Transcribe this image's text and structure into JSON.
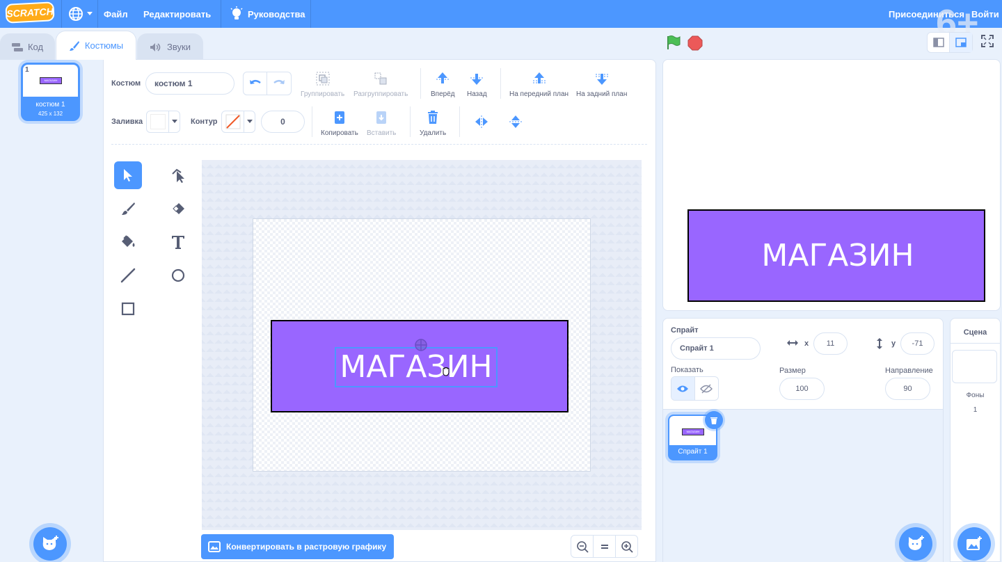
{
  "menu": {
    "logo": "SCRATCH",
    "file": "Файл",
    "edit": "Редактировать",
    "tutorials": "Руководства",
    "join": "Присоединиться",
    "signin": "Войти",
    "age_badge": "6+"
  },
  "tabs": {
    "code": "Код",
    "costumes": "Костюмы",
    "sounds": "Звуки"
  },
  "costume_list": {
    "items": [
      {
        "index": "1",
        "name": "костюм 1",
        "size": "425 x 132",
        "thumb_text": "МАГАЗИН"
      }
    ]
  },
  "toolbar": {
    "costume_label": "Костюм",
    "costume_name": "костюм 1",
    "group": "Группировать",
    "ungroup": "Разгруппировать",
    "forward": "Вперёд",
    "backward": "Назад",
    "front": "На передний план",
    "back": "На задний план",
    "fill_label": "Заливка",
    "outline_label": "Контур",
    "outline_width": "0",
    "copy": "Копировать",
    "paste": "Вставить",
    "delete": "Удалить"
  },
  "canvas": {
    "text": "МАГАЗИН",
    "rect_color": "#9966ff",
    "convert_button": "Конвертировать в растровую графику"
  },
  "stage": {
    "text": "МАГАЗИН"
  },
  "sprite_info": {
    "sprite_label": "Спрайт",
    "sprite_name": "Спрайт 1",
    "x_label": "x",
    "x_value": "11",
    "y_label": "y",
    "y_value": "-71",
    "show_label": "Показать",
    "size_label": "Размер",
    "size_value": "100",
    "direction_label": "Направление",
    "direction_value": "90"
  },
  "sprites": [
    {
      "name": "Спрайт 1",
      "thumb_text": "МАГАЗИН"
    }
  ],
  "stage_panel": {
    "title": "Сцена",
    "backdrops_label": "Фоны",
    "backdrops_count": "1"
  },
  "colors": {
    "accent": "#4c97ff",
    "sprite_purple": "#9966ff",
    "go_flag": "#4cbf56",
    "stop": "#ec5959"
  }
}
